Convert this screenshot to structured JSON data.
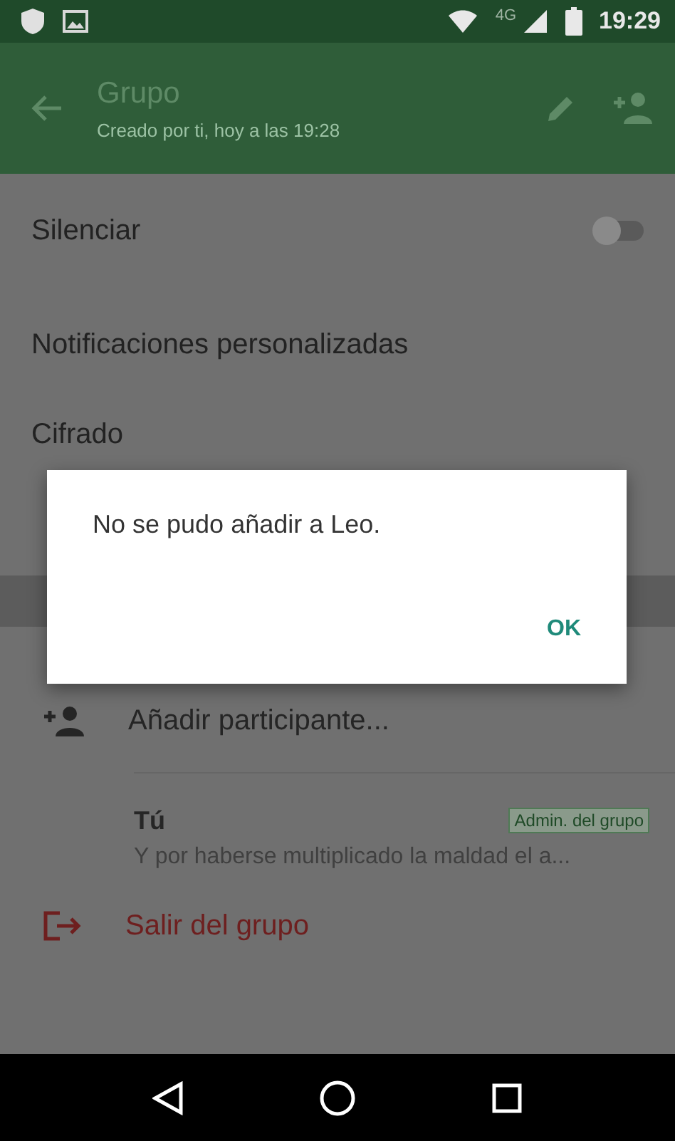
{
  "status_bar": {
    "network": "4G",
    "time": "19:29"
  },
  "app_bar": {
    "title": "Grupo",
    "subtitle": "Creado por ti, hoy a las 19:28"
  },
  "settings": [
    {
      "label": "Silenciar",
      "kind": "toggle",
      "on": false
    },
    {
      "label": "Notificaciones personalizadas",
      "kind": "plain"
    },
    {
      "label": "Cifrado",
      "kind": "plain"
    }
  ],
  "participants": {
    "add_label": "Añadir participante...",
    "members": [
      {
        "name": "Tú",
        "status": "Y por haberse multiplicado la maldad el a...",
        "badge": "Admin. del grupo"
      }
    ]
  },
  "exit_label": "Salir del grupo",
  "dialog": {
    "message": "No se pudo añadir a Leo.",
    "button": "OK"
  }
}
